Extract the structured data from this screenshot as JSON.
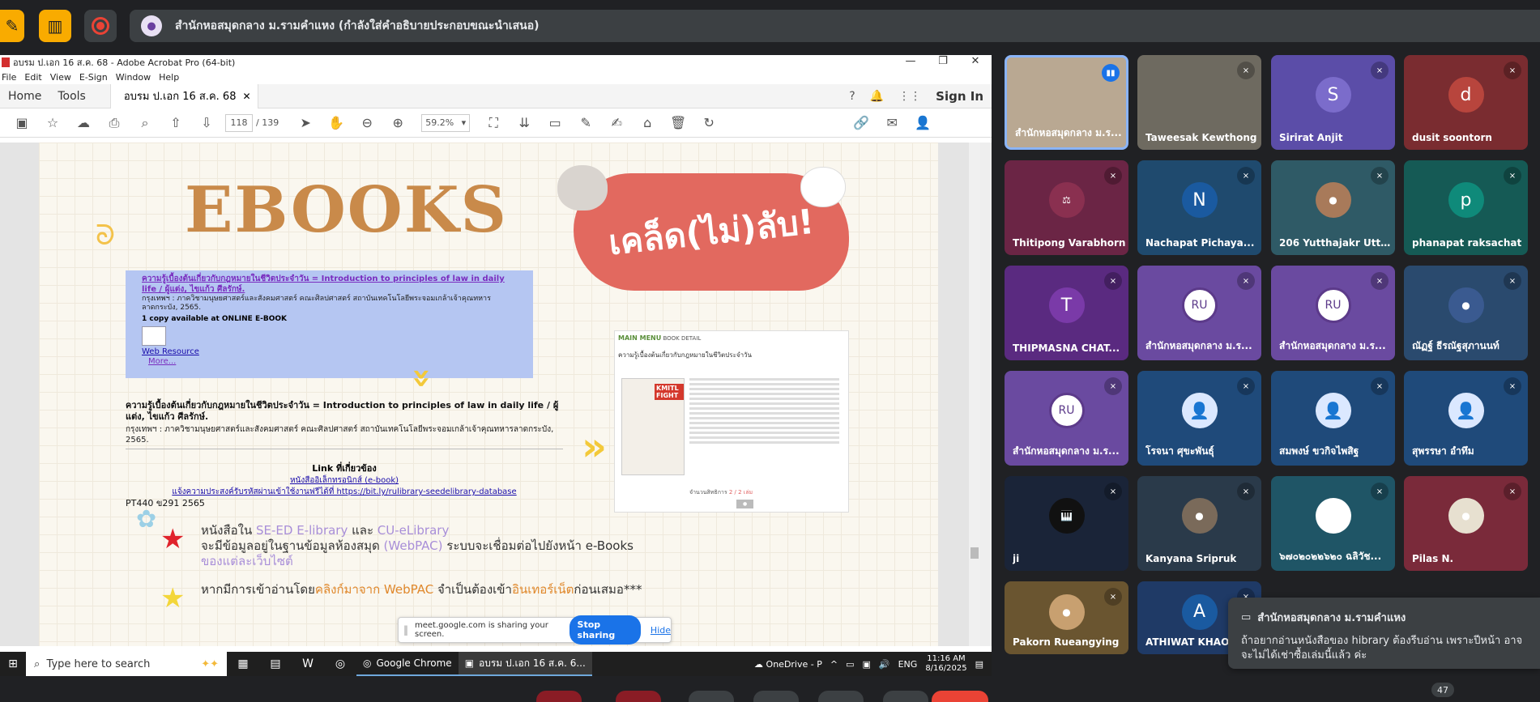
{
  "meet": {
    "presentation_title": "สำนักหอสมุดกลาง ม.รามคำแหง (กำลังใส่คำอธิบายประกอบขณะนำเสนอ)",
    "participant_count": "47"
  },
  "acrobat": {
    "window_title": "อบรม ป.เอก 16 ส.ค. 68 - Adobe Acrobat Pro (64-bit)",
    "menu": [
      "File",
      "Edit",
      "View",
      "E-Sign",
      "Window",
      "Help"
    ],
    "tab_home": "Home",
    "tab_tools": "Tools",
    "doc_tab": "อบรม ป.เอก 16 ส.ค. 68",
    "sign_in": "Sign In",
    "page_current": "118",
    "page_total": "/ 139",
    "zoom": "59.2%"
  },
  "slide": {
    "title": "EBOOKS",
    "badge": "เคล็ด(ไม่)ลับ!",
    "catalog": {
      "title_line": "ความรู้เบื้องต้นเกี่ยวกับกฎหมายในชีวิตประจำวัน = Introduction to principles of law in daily life / ผู้แต่ง, ไขแก้ว ศีลรักษ์.",
      "publisher": "กรุงเทพฯ : ภาควิชามนุษยศาสตร์และสังคมศาสตร์ คณะศิลปศาสตร์ สถาบันเทคโนโลยีพระจอมเกล้าเจ้าคุณทหารลาดกระบัง, 2565.",
      "copies": "1 copy available at ONLINE E-BOOK",
      "web_resource": "Web Resource",
      "more": "More..."
    },
    "detail": {
      "title": "ความรู้เบื้องต้นเกี่ยวกับกฎหมายในชีวิตประจำวัน = Introduction to principles of law in daily life / ผู้แต่ง, ไขแก้ว ศีลรักษ์.",
      "publisher": "กรุงเทพฯ : ภาควิชามนุษยศาสตร์และสังคมศาสตร์ คณะศิลปศาสตร์ สถาบันเทคโนโลยีพระจอมเกล้าเจ้าคุณทหารลาดกระบัง, 2565.",
      "links_heading": "Link ที่เกี่ยวข้อง",
      "link1": "หนังสืออิเล็กทรอนิกส์ (e-book)",
      "link2": "แจ้งความประสงค์รับรหัสผ่านเข้าใช้งานฟรีได้ที่ https://bit.ly/rulibrary-seedelibrary-database",
      "call_number": "PT440 ข291 2565"
    },
    "screenshot": {
      "main_menu": "MAIN MENU",
      "book_detail": "BOOK DETAIL",
      "book_title": "ความรู้เบื้องต้นเกี่ยวกับกฎหมายในชีวิตประจำวัน",
      "cover_badge": "KMITL FIGHT",
      "rights": "จำนวนสิทธิการ",
      "rights_value": "2 / 2 เล่ม"
    },
    "bullet1_a": "หนังสือใน ",
    "bullet1_hl1": "SE-ED E-library",
    "bullet1_b": " และ ",
    "bullet1_hl2": "CU-eLibrary",
    "bullet1_c": "จะมีข้อมูลอยู่ในฐานข้อมูลห้องสมุด ",
    "bullet1_hl3": "(WebPAC)",
    "bullet1_d": " ระบบจะเชื่อมต่อไปยังหน้า e-Books",
    "bullet1_e": "ของแต่ละเว็บไซต์",
    "bullet2_a": "หากมีการเข้าอ่านโดย",
    "bullet2_hl1": "คลิงก์มาจาก WebPAC",
    "bullet2_b": " จำเป็นต้องเข้า",
    "bullet2_hl2": "อินเทอร์เน็ต",
    "bullet2_c": "ก่อนเสมอ***"
  },
  "share_bar": {
    "message": "meet.google.com is sharing your screen.",
    "stop": "Stop sharing",
    "hide": "Hide"
  },
  "taskbar": {
    "search_placeholder": "Type here to search",
    "chrome": "Google Chrome",
    "acrobat": "อบรม ป.เอก 16 ส.ค. 6...",
    "onedrive": "OneDrive - P",
    "lang": "ENG",
    "time": "11:16 AM",
    "date": "8/16/2025"
  },
  "participants": [
    {
      "name": "สำนักหอสมุดกลาง ม.ร...",
      "type": "video",
      "color": "#b9a892",
      "initial": "",
      "speaking": true
    },
    {
      "name": "Taweesak Kewthong",
      "type": "video",
      "color": "#6e6a60",
      "initial": ""
    },
    {
      "name": "Sirirat Anjit",
      "type": "initial",
      "color": "#5b4da8",
      "avatar": "#7b6ccb",
      "initial": "S"
    },
    {
      "name": "dusit soontorn",
      "type": "initial",
      "color": "#7a2c30",
      "avatar": "#b8453d",
      "initial": "d"
    },
    {
      "name": "Thitipong Varabhorn",
      "type": "photo",
      "color": "#6b2545",
      "avatar": "#8a3050",
      "initial": "⚖"
    },
    {
      "name": "Nachapat Pichaya...",
      "type": "initial",
      "color": "#1f4a6e",
      "avatar": "#1a5aa0",
      "initial": "N"
    },
    {
      "name": "206 Yutthajakr Utta...",
      "type": "photo",
      "color": "#2f5a66",
      "avatar": "#a87a5a",
      "initial": "●"
    },
    {
      "name": "phanapat raksachat",
      "type": "initial",
      "color": "#155a55",
      "avatar": "#0f8a7a",
      "initial": "p"
    },
    {
      "name": "THIPMASNA CHAT...",
      "type": "initial",
      "color": "#5a2a80",
      "avatar": "#7a3aa8",
      "initial": "T"
    },
    {
      "name": "สำนักหอสมุดกลาง ม.ร...",
      "type": "seal",
      "color": "#6a4aa0",
      "initial": "RU"
    },
    {
      "name": "สำนักหอสมุดกลาง ม.ร...",
      "type": "seal",
      "color": "#6a4aa0",
      "initial": "RU"
    },
    {
      "name": "ณัฏฐ์ ธีรณัฐสุภานนท์",
      "type": "photo",
      "color": "#2a4a6e",
      "avatar": "#3a5a90",
      "initial": "●"
    },
    {
      "name": "สำนักหอสมุดกลาง ม.ร...",
      "type": "seal",
      "color": "#6a4aa0",
      "initial": "RU"
    },
    {
      "name": "โรจนา ศุขะพันธุ์",
      "type": "person",
      "color": "#1f4a7a",
      "initial": "👤"
    },
    {
      "name": "สมพงษ์ ขวกิจไพสิฐ",
      "type": "person",
      "color": "#1f4a7a",
      "initial": "👤"
    },
    {
      "name": "สุพรรษา อำทึม",
      "type": "person",
      "color": "#1f4a7a",
      "initial": "👤"
    },
    {
      "name": "ji",
      "type": "photo",
      "color": "#1a2438",
      "avatar": "#111",
      "initial": "🎹"
    },
    {
      "name": "Kanyana Sripruk",
      "type": "photo",
      "color": "#2a3a4a",
      "avatar": "#7a6a5a",
      "initial": "●"
    },
    {
      "name": "๖๗๐๒๐๒๒๖๒๐ ฉลิวัช...",
      "type": "photo",
      "color": "#1f5566",
      "avatar": "#fff",
      "initial": "●"
    },
    {
      "name": "Pilas N.",
      "type": "photo",
      "color": "#7a2a3a",
      "avatar": "#e7e0d0",
      "initial": "●"
    },
    {
      "name": "Pakorn Rueangying",
      "type": "photo",
      "color": "#6a5530",
      "avatar": "#c8a070",
      "initial": "●"
    },
    {
      "name": "ATHIWAT KHAOSA...",
      "type": "initial",
      "color": "#1f3a66",
      "avatar": "#1a5aa0",
      "initial": "A"
    }
  ],
  "toast": {
    "sender": "สำนักหอสมุดกลาง ม.รามคำแหง",
    "message": "ถ้าอยากอ่านหนังสือของ hibrary ต้องรีบอ่าน เพราะปีหน้า อาจจะไม่ได้เช่าซื้อเล่มนี้แล้ว ค่ะ"
  }
}
